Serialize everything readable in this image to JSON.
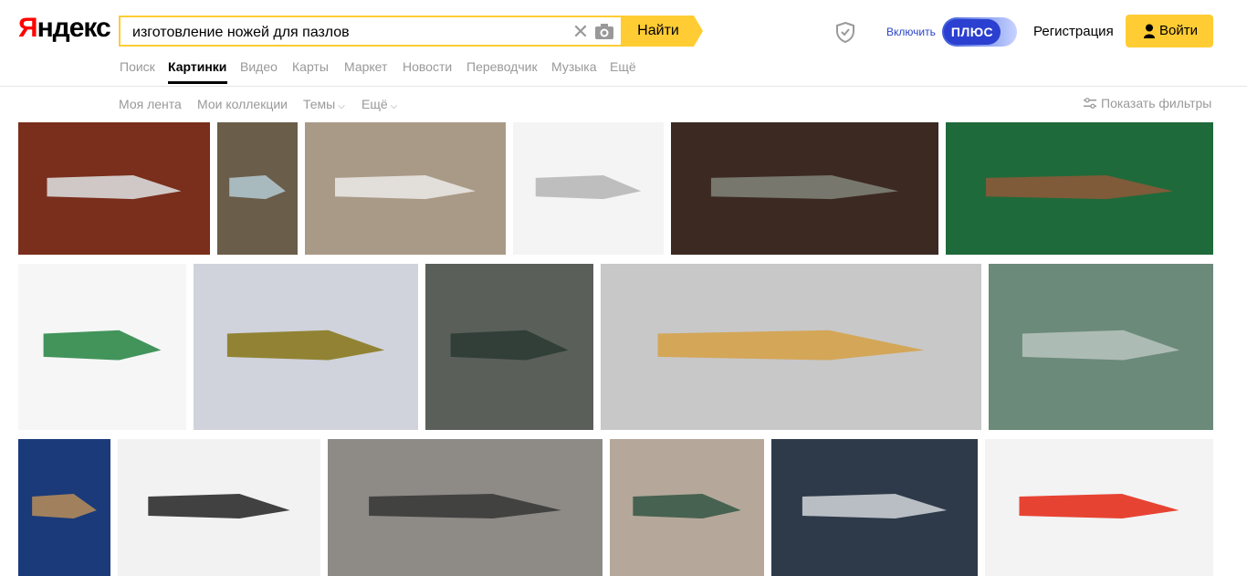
{
  "header": {
    "logo": "Яндекс",
    "search": {
      "value": "изготовление ножей для пазлов",
      "placeholder": ""
    },
    "find_label": "Найти",
    "plus_prefix": "Включить",
    "plus_label": "ПЛЮС",
    "register_label": "Регистрация",
    "login_label": "Войти"
  },
  "services": [
    {
      "label": "Поиск",
      "active": false
    },
    {
      "label": "Картинки",
      "active": true
    },
    {
      "label": "Видео",
      "active": false
    },
    {
      "label": "Карты",
      "active": false
    },
    {
      "label": "Маркет",
      "active": false
    },
    {
      "label": "Новости",
      "active": false
    },
    {
      "label": "Переводчик",
      "active": false
    },
    {
      "label": "Музыка",
      "active": false
    },
    {
      "label": "Ещё",
      "active": false
    }
  ],
  "subnav": {
    "feed": "Моя лента",
    "collections": "Мои коллекции",
    "themes": "Темы",
    "more": "Ещё",
    "filters": "Показать фильтры"
  },
  "colors": {
    "accent": "#ffcc33",
    "logo_red": "#ff0000",
    "plus_blue": "#2b3fd0"
  },
  "images": [
    {
      "subject": "knife on leather",
      "bg": "#7a2e1c",
      "fg": "#d9d9d9"
    },
    {
      "subject": "two knives in sheaths",
      "bg": "#6a5d4a",
      "fg": "#b0c4cc"
    },
    {
      "subject": "blank blade on wood",
      "bg": "#a99a87",
      "fg": "#e8e6e2"
    },
    {
      "subject": "blade templates drawing",
      "bg": "#f4f4f4",
      "fg": "#b8b8b8"
    },
    {
      "subject": "blade with clamp",
      "bg": "#3c2a22",
      "fg": "#7d8075"
    },
    {
      "subject": "knives on green mat",
      "bg": "#1f6a3a",
      "fg": "#8a5a3a"
    },
    {
      "subject": "decorative knife",
      "bg": "#f6f6f6",
      "fg": "#2f8a4a"
    },
    {
      "subject": "knife with finger holes",
      "bg": "#d0d2dc",
      "fg": "#8a7a20"
    },
    {
      "subject": "knife with leather sheath",
      "bg": "#5a5f5a",
      "fg": "#2e3b34"
    },
    {
      "subject": "blades with wooden handles",
      "bg": "#c8c8c8",
      "fg": "#d5a24b"
    },
    {
      "subject": "blade and whetstone",
      "bg": "#6b8a7a",
      "fg": "#b5c0bb"
    },
    {
      "subject": "engraved knife",
      "bg": "#1a3a7a",
      "fg": "#b08a5a"
    },
    {
      "subject": "blade on leather pieces",
      "bg": "#f2f2f2",
      "fg": "#2e2e2e"
    },
    {
      "subject": "folding knives collage",
      "bg": "#8e8a86",
      "fg": "#3a3a3a"
    },
    {
      "subject": "knife on stone",
      "bg": "#b5a89a",
      "fg": "#3b5a48"
    },
    {
      "subject": "blade in vise",
      "bg": "#2e3a4a",
      "fg": "#c9cdd2"
    },
    {
      "subject": "knife with red sheath",
      "bg": "#f3f3f3",
      "fg": "#e5301e"
    }
  ]
}
